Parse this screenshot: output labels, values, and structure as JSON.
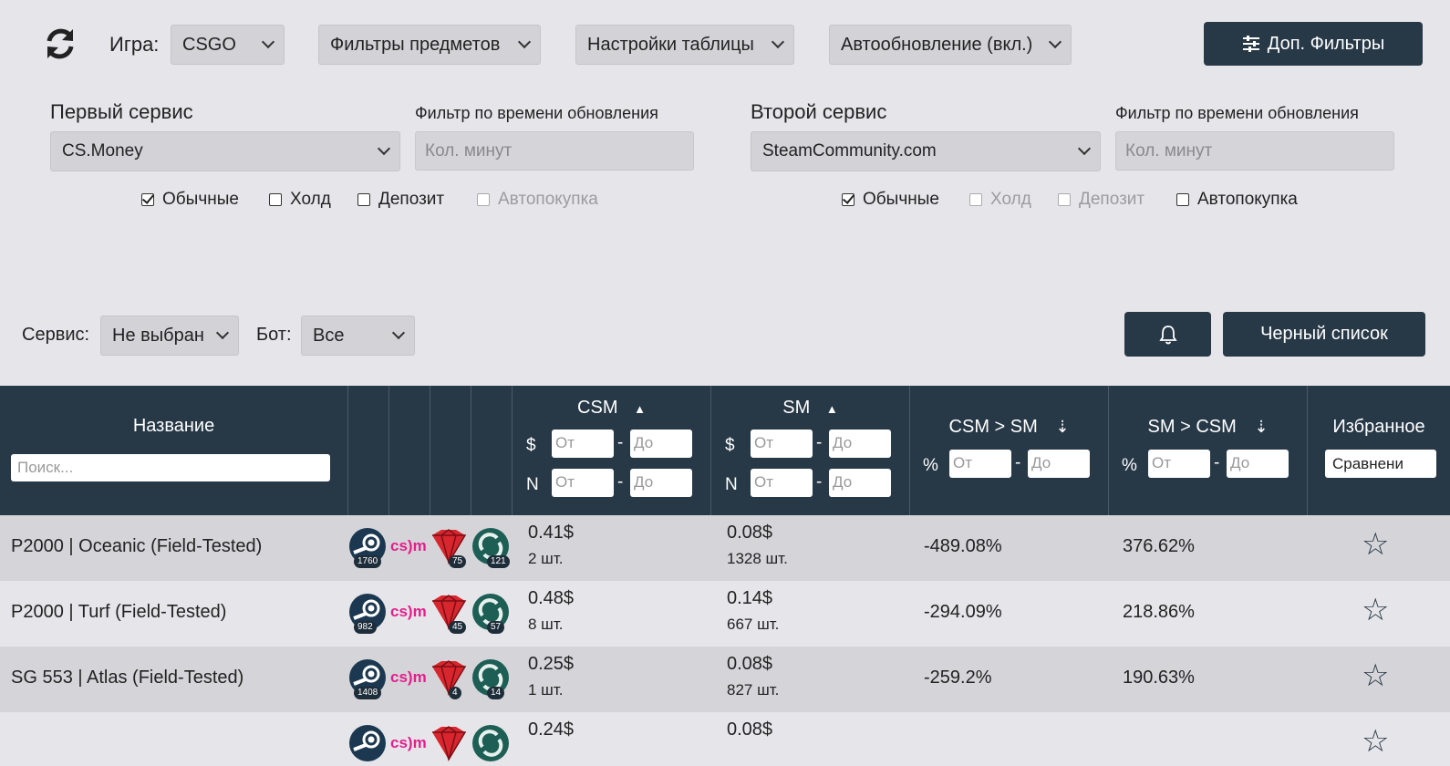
{
  "toolbar": {
    "refresh_icon": "refresh-icon",
    "game_label": "Игра:",
    "game_value": "CSGO",
    "item_filters": "Фильтры предметов",
    "table_settings": "Настройки таблицы",
    "auto_update": "Автообновление (вкл.)",
    "extra_filters": "Доп. Фильтры"
  },
  "first_service": {
    "label": "Первый сервис",
    "value": "CS.Money",
    "time_filter_label": "Фильтр по времени обновления",
    "time_filter_placeholder": "Кол. минут",
    "checks": [
      {
        "label": "Обычные",
        "checked": true,
        "disabled": false
      },
      {
        "label": "Холд",
        "checked": false,
        "disabled": false
      },
      {
        "label": "Депозит",
        "checked": false,
        "disabled": false
      },
      {
        "label": "Автопокупка",
        "checked": false,
        "disabled": true
      }
    ]
  },
  "second_service": {
    "label": "Второй сервис",
    "value": "SteamCommunity.com",
    "time_filter_label": "Фильтр по времени обновления",
    "time_filter_placeholder": "Кол. минут",
    "checks": [
      {
        "label": "Обычные",
        "checked": true,
        "disabled": false
      },
      {
        "label": "Холд",
        "checked": false,
        "disabled": true
      },
      {
        "label": "Депозит",
        "checked": false,
        "disabled": true
      },
      {
        "label": "Автопокупка",
        "checked": false,
        "disabled": false
      }
    ]
  },
  "filter_bar": {
    "service_label": "Сервис:",
    "service_value": "Не выбран",
    "bot_label": "Бот:",
    "bot_value": "Все",
    "bell_icon": "bell-icon",
    "blacklist": "Черный список"
  },
  "table": {
    "headers": {
      "name": "Название",
      "search_placeholder": "Поиск...",
      "csm": "CSM",
      "sm": "SM",
      "csm_sm": "CSM > SM",
      "sm_csm": "SM > CSM",
      "favorites": "Избранное",
      "favorites_select": "Сравнени",
      "dollar": "$",
      "n": "N",
      "percent": "%",
      "from": "От",
      "to": "До",
      "dash": "-"
    },
    "rows": [
      {
        "name": "P2000 | Oceanic (Field-Tested)",
        "steam": "1760",
        "gem": "75",
        "green": "121",
        "csm_price": "0.41$",
        "csm_qty": "2 шт.",
        "sm_price": "0.08$",
        "sm_qty": "1328 шт.",
        "csm_sm": "-489.08%",
        "sm_csm": "376.62%"
      },
      {
        "name": "P2000 | Turf (Field-Tested)",
        "steam": "982",
        "gem": "45",
        "green": "57",
        "csm_price": "0.48$",
        "csm_qty": "8 шт.",
        "sm_price": "0.14$",
        "sm_qty": "667 шт.",
        "csm_sm": "-294.09%",
        "sm_csm": "218.86%"
      },
      {
        "name": "SG 553 | Atlas (Field-Tested)",
        "steam": "1408",
        "gem": "4",
        "green": "14",
        "csm_price": "0.25$",
        "csm_qty": "1 шт.",
        "sm_price": "0.08$",
        "sm_qty": "827 шт.",
        "csm_sm": "-259.2%",
        "sm_csm": "190.63%"
      },
      {
        "name": "",
        "steam": "",
        "gem": "",
        "green": "",
        "csm_price": "0.24$",
        "csm_qty": "",
        "sm_price": "0.08$",
        "sm_qty": "",
        "csm_sm": "",
        "sm_csm": ""
      }
    ],
    "csm_logo": "cs)m",
    "colors": {
      "header": "#273847",
      "row_odd": "#d5d5d9",
      "row_even": "#e6e6ea",
      "csm_logo": "#e0208c",
      "gem": "#d7262e",
      "steam": "#1b3850",
      "green": "#1d5e55"
    }
  }
}
